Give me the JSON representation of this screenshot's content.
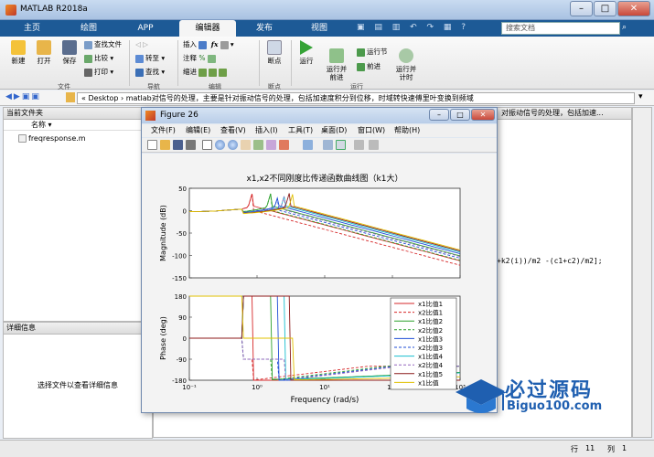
{
  "window": {
    "title": "MATLAB R2018a"
  },
  "tabs": [
    "主页",
    "绘图",
    "APP",
    "编辑器",
    "发布",
    "视图"
  ],
  "search": {
    "placeholder": "搜索文档"
  },
  "ribbon": {
    "new": "新建",
    "open": "打开",
    "save": "保存",
    "find_files": "查找文件",
    "compare": "比较",
    "print": "打印",
    "goto": "转至",
    "find": "查找",
    "insert": "插入",
    "comment": "注释",
    "indent": "缩进",
    "breakpoints": "断点",
    "run": "运行",
    "run_advance": "运行并\n前进",
    "run_section": "运行节",
    "advance": "前进",
    "run_time": "运行并\n计时",
    "groups": {
      "file": "文件",
      "nav": "导航",
      "edit": "编辑",
      "bp": "断点",
      "run": "运行"
    }
  },
  "address": {
    "path": "« Desktop › matlab对信号的处理，主要是针对振动信号的处理，包括加速度积分到位移，时域转快速傅里叶变换到频域"
  },
  "current_folder": {
    "title": "当前文件夹",
    "col_name": "名称 ▾",
    "files": [
      "freqresponse.m"
    ]
  },
  "details": {
    "title": "详细信息",
    "placeholder": "选择文件以查看详细信息"
  },
  "editor_bg": {
    "path_tail": "对振动信号的处理，包括加速...",
    "code_line": "+k2(i))/m2 -(c1+c2)/m2];"
  },
  "status": {
    "row_label": "行",
    "row": "11",
    "col_label": "列",
    "col": "1"
  },
  "figure": {
    "title": "Figure 26",
    "menu": [
      "文件(F)",
      "编辑(E)",
      "查看(V)",
      "插入(I)",
      "工具(T)",
      "桌面(D)",
      "窗口(W)",
      "帮助(H)"
    ]
  },
  "chart_data": {
    "type": "line",
    "title": "x1,x2不同刚度比传递函数曲线图（k1大）",
    "xlabel": "Frequency  (rad/s)",
    "xscale": "log",
    "xlim": [
      0.1,
      1000
    ],
    "xticks": [
      "10⁻¹",
      "10⁰",
      "10¹",
      "10²",
      "10³"
    ],
    "subplots": [
      {
        "ylabel": "Magnitude (dB)",
        "ylim": [
          -150,
          50
        ],
        "yticks": [
          50,
          0,
          -50,
          -100,
          -150
        ]
      },
      {
        "ylabel": "Phase (deg)",
        "ylim": [
          -180,
          180
        ],
        "yticks": [
          180,
          90,
          0,
          -90,
          -180
        ]
      }
    ],
    "legend_position": "bottom-right",
    "series": [
      {
        "name": "x1比值1",
        "color": "#d62728",
        "dash": "solid",
        "peak": 0.85
      },
      {
        "name": "x2比值1",
        "color": "#d62728",
        "dash": "dashed",
        "peak": 0.85
      },
      {
        "name": "x1比值2",
        "color": "#2ca02c",
        "dash": "solid",
        "peak": 1.6
      },
      {
        "name": "x2比值2",
        "color": "#2ca02c",
        "dash": "dashed",
        "peak": 1.6
      },
      {
        "name": "x1比值3",
        "color": "#1f4ed6",
        "dash": "solid",
        "peak": 2.1
      },
      {
        "name": "x2比值3",
        "color": "#1f4ed6",
        "dash": "dashed",
        "peak": 2.1
      },
      {
        "name": "x1比值4",
        "color": "#17becf",
        "dash": "solid",
        "peak": 2.6
      },
      {
        "name": "x2比值4",
        "color": "#9467bd",
        "dash": "dashed",
        "peak": 2.6
      },
      {
        "name": "x1比值5",
        "color": "#8c1a1a",
        "dash": "solid",
        "peak": 3.0
      },
      {
        "name": "x1比值",
        "color": "#e0c000",
        "dash": "solid",
        "peak": 3.4
      }
    ]
  },
  "brand": {
    "name": "必过源码",
    "url": "Biguo100.com"
  }
}
